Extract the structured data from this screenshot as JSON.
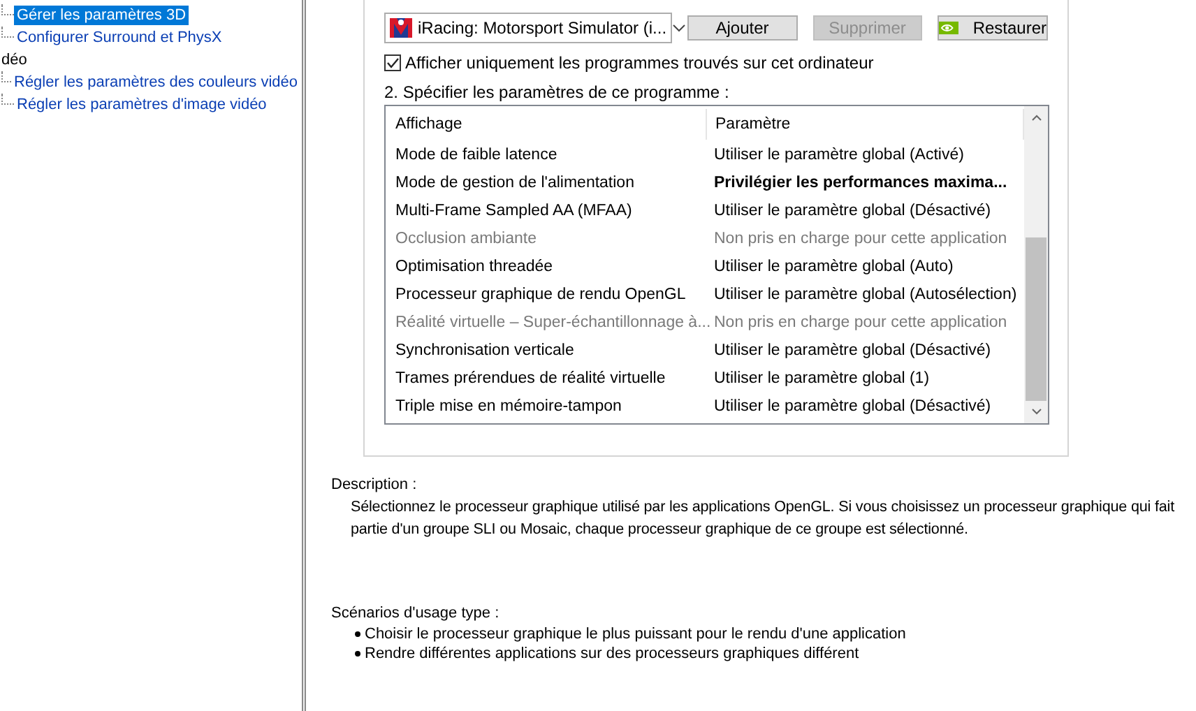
{
  "sidebar": {
    "groups": [
      {
        "items": [
          {
            "label": "Gérer les paramètres 3D",
            "selected": true
          },
          {
            "label": "Configurer Surround et PhysX",
            "selected": false
          }
        ]
      },
      {
        "label": "déo",
        "items": [
          {
            "label": "Régler les paramètres des couleurs vidéo",
            "selected": false
          },
          {
            "label": "Régler les paramètres d'image vidéo",
            "selected": false
          }
        ]
      }
    ]
  },
  "program": {
    "dropdown": {
      "value": "iRacing: Motorsport Simulator (i..."
    },
    "buttons": [
      {
        "label": "Ajouter",
        "kind": "plain",
        "disabled": false
      },
      {
        "label": "Supprimer",
        "kind": "plain",
        "disabled": true
      },
      {
        "label": "Restaurer",
        "kind": "brand",
        "disabled": false
      }
    ],
    "checkbox": {
      "label": "Afficher uniquement les programmes trouvés sur cet ordinateur",
      "checked": true
    }
  },
  "settings": {
    "heading": "2. Spécifier les paramètres de ce programme :",
    "columns": [
      "Affichage",
      "Paramètre"
    ],
    "rows": [
      {
        "feature": "Mode de faible latence",
        "setting": "Utiliser le paramètre global (Activé)",
        "disabled": false,
        "modified": false
      },
      {
        "feature": "Mode de gestion de l'alimentation",
        "setting": "Privilégier les performances maxima...",
        "disabled": false,
        "modified": true
      },
      {
        "feature": "Multi-Frame Sampled AA (MFAA)",
        "setting": "Utiliser le paramètre global (Désactivé)",
        "disabled": false,
        "modified": false
      },
      {
        "feature": "Occlusion ambiante",
        "setting": "Non pris en charge pour cette application",
        "disabled": true,
        "modified": false
      },
      {
        "feature": "Optimisation threadée",
        "setting": "Utiliser le paramètre global (Auto)",
        "disabled": false,
        "modified": false
      },
      {
        "feature": "Processeur graphique de rendu OpenGL",
        "setting": "Utiliser le paramètre global (Autosélection)",
        "disabled": false,
        "modified": false
      },
      {
        "feature": "Réalité virtuelle – Super-échantillonnage à...",
        "setting": "Non pris en charge pour cette application",
        "disabled": true,
        "modified": false
      },
      {
        "feature": "Synchronisation verticale",
        "setting": "Utiliser le paramètre global (Désactivé)",
        "disabled": false,
        "modified": false
      },
      {
        "feature": "Trames prérendues de réalité virtuelle",
        "setting": "Utiliser le paramètre global (1)",
        "disabled": false,
        "modified": false
      },
      {
        "feature": "Triple mise en mémoire-tampon",
        "setting": "Utiliser le paramètre global (Désactivé)",
        "disabled": false,
        "modified": false
      }
    ]
  },
  "description": {
    "label": "Description :",
    "text": "Sélectionnez le processeur graphique utilisé par les applications OpenGL. Si vous choisissez un processeur graphique qui fait partie d'un groupe SLI ou Mosaic, chaque processeur graphique de ce groupe est sélectionné."
  },
  "scenarios": {
    "label": "Scénarios d'usage type :",
    "items": [
      "Choisir le processeur graphique le plus puissant pour le rendu d'une application",
      "Rendre différentes applications sur des processeurs graphiques différent"
    ]
  }
}
